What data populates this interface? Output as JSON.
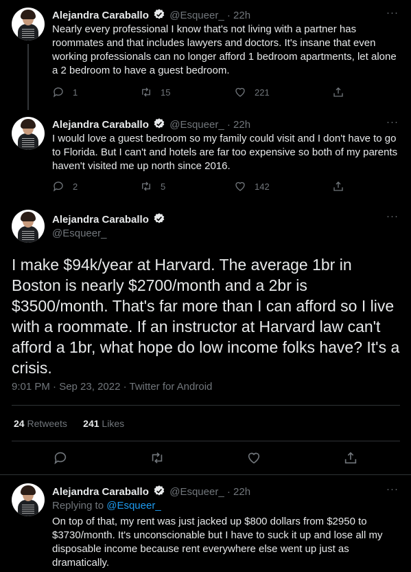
{
  "author": {
    "name": "Alejandra Caraballo",
    "handle": "@Esqueer_"
  },
  "tweets": [
    {
      "handle_time": "@Esqueer_ · 22h",
      "text": "Nearly every professional I know that's not living with a partner has roommates and that includes lawyers and doctors. It's insane that even working professionals can no longer afford 1 bedroom apartments, let alone a 2 bedroom to have a guest bedroom.",
      "replies": "1",
      "retweets": "15",
      "likes": "221"
    },
    {
      "handle_time": "@Esqueer_ · 22h",
      "text": "I would love a guest bedroom so my family could visit and I don't have to go to Florida. But I can't and hotels are far too expensive so both of my parents haven't visited me up north since 2016.",
      "replies": "2",
      "retweets": "5",
      "likes": "142"
    }
  ],
  "main_tweet": {
    "text": "I make $94k/year at Harvard. The average 1br in Boston is nearly $2700/month and a 2br is $3500/month. That's far more than I can afford so I live with a roommate. If an instructor at Harvard law can't afford a 1br, what hope do low income folks have? It's a crisis.",
    "meta": "9:01 PM · Sep 23, 2022 · Twitter for Android",
    "retweets_count": "24",
    "retweets_label": "Retweets",
    "likes_count": "241",
    "likes_label": "Likes"
  },
  "reply_tweet": {
    "handle_time": "@Esqueer_ · 22h",
    "replying_prefix": "Replying to",
    "replying_handle": "@Esqueer_",
    "text": "On top of that, my rent was just jacked up $800 dollars from $2950 to $3730/month. It's unconscionable but I have to suck it up and lose all my disposable income because rent everywhere else went up just as dramatically."
  },
  "more_label": "···",
  "colors": {
    "background": "#000000",
    "text": "#e7e9ea",
    "muted": "#71767b",
    "link": "#1d9bf0",
    "verified": "#e7e9ea"
  }
}
